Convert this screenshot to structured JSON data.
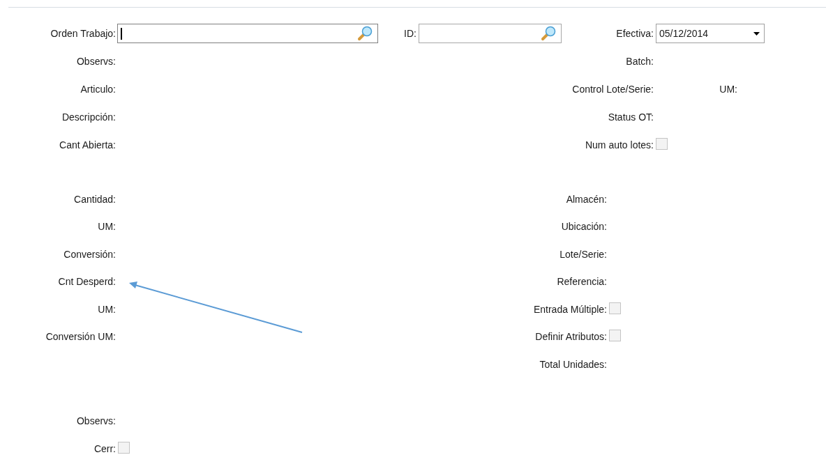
{
  "header_fields": [
    {
      "label": "Orden Trabajo:",
      "kind": "lookup",
      "focused": true
    },
    {
      "label": "ID:",
      "kind": "lookup",
      "focused": false
    },
    {
      "label": "Efectiva:",
      "kind": "date",
      "value": "05/12/2014"
    }
  ],
  "order_rows": [
    {
      "left": "Observs:",
      "right": {
        "label": "Batch:",
        "kind": "text"
      }
    },
    {
      "left": "Articulo:",
      "right": {
        "label": "Control Lote/Serie:",
        "kind": "text",
        "extra_label": "UM:"
      }
    },
    {
      "left": "Descripción:",
      "right": {
        "label": "Status OT:",
        "kind": "text"
      }
    },
    {
      "left": "Cant Abierta:",
      "right": {
        "label": "Num auto lotes:",
        "kind": "checkbox",
        "checked": false
      }
    }
  ],
  "quantity_rows": [
    {
      "left": "Cantidad:",
      "right": {
        "label": "Almacén:",
        "kind": "text"
      }
    },
    {
      "left": "UM:",
      "right": {
        "label": "Ubicación:",
        "kind": "text"
      }
    },
    {
      "left": "Conversión:",
      "right": {
        "label": "Lote/Serie:",
        "kind": "text"
      }
    },
    {
      "left": "Cnt Desperd:",
      "right": {
        "label": "Referencia:",
        "kind": "text"
      }
    },
    {
      "left": "UM:",
      "right": {
        "label": "Entrada Múltiple:",
        "kind": "checkbox",
        "checked": false
      }
    },
    {
      "left": "Conversión UM:",
      "right": {
        "label": "Definir Atributos:",
        "kind": "checkbox",
        "checked": false
      }
    },
    {
      "right": {
        "label": "Total Unidades:",
        "kind": "text"
      }
    }
  ],
  "footer_rows": [
    {
      "label": "Observs:",
      "kind": "text"
    },
    {
      "label": "Cerr:",
      "kind": "checkbox",
      "checked": false
    }
  ],
  "annotation": {
    "kind": "arrow"
  }
}
